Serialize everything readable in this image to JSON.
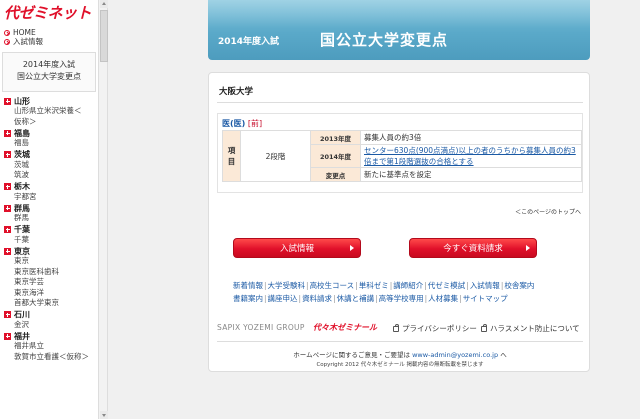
{
  "sidebar": {
    "logo": "代ゼミネット",
    "nav": [
      "HOME",
      "入試情報"
    ],
    "box_line1": "2014年度入試",
    "box_line2": "国公立大学変更点",
    "prefectures": [
      {
        "name": "山形",
        "subs": [
          "山形県立米沢栄養＜",
          "仮称＞"
        ]
      },
      {
        "name": "福島",
        "subs": [
          "福島"
        ]
      },
      {
        "name": "茨城",
        "subs": [
          "茨城",
          "筑波"
        ]
      },
      {
        "name": "栃木",
        "subs": [
          "宇都宮"
        ]
      },
      {
        "name": "群馬",
        "subs": [
          "群馬"
        ]
      },
      {
        "name": "千葉",
        "subs": [
          "千葉"
        ]
      },
      {
        "name": "東京",
        "subs": [
          "東京",
          "東京医科歯科",
          "東京学芸",
          "東京海洋",
          "首都大学東京"
        ]
      },
      {
        "name": "石川",
        "subs": [
          "金沢"
        ]
      },
      {
        "name": "福井",
        "subs": [
          "福井県立",
          "敦賀市立看護＜仮称＞"
        ]
      }
    ]
  },
  "banner": {
    "year": "2014年度入試",
    "title": "国公立大学変更点"
  },
  "main": {
    "university": "大阪大学",
    "dept_name": "医(医)",
    "dept_tag": "[前]",
    "table": {
      "item_label": "項目",
      "schedule": "2段階",
      "rows": [
        {
          "label": "2013年度",
          "value": "募集人員の約3倍",
          "link": false
        },
        {
          "label": "2014年度",
          "value": "センター630点(900点満点)以上の者のうちから募集人員の約3倍まで第1段階選抜の合格とする",
          "link": true
        },
        {
          "label": "変更点",
          "value": "新たに基準点を設定",
          "link": false
        }
      ]
    },
    "page_top": "＜このページのトップへ",
    "buttons": {
      "info": "入試情報",
      "request": "今すぐ資料請求"
    },
    "footer_links_row1": [
      "新着情報",
      "大学受験科",
      "高校生コース",
      "単科ゼミ",
      "講師紹介",
      "代ゼミ模試",
      "入試情報",
      "校舎案内"
    ],
    "footer_links_row2": [
      "書籍案内",
      "講座申込",
      "資料請求",
      "休講と補講",
      "高等学校専用",
      "人材募集",
      "サイトマップ"
    ],
    "sapix": "SAPIX YOZEMI GROUP",
    "yozemi": "代々木ゼミナール",
    "privacy": "プライバシーポリシー",
    "harassment": "ハラスメント防止について",
    "contact_prefix": "ホームページに関するご意見・ご要望は",
    "contact_mail": "www-admin@yozemi.co.jp",
    "contact_suffix": "へ",
    "copyright": "Copyright 2012 代々木ゼミナール 掲載内容の無断転載を禁じます"
  }
}
